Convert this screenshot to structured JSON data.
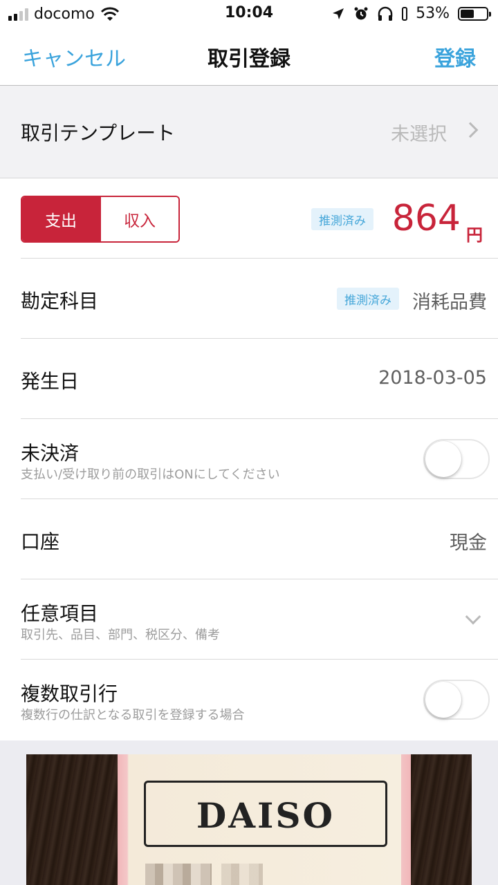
{
  "status_bar": {
    "carrier": "docomo",
    "time": "10:04",
    "battery_percent_text": "53%",
    "battery_level": 0.53
  },
  "nav": {
    "cancel_label": "キャンセル",
    "title": "取引登録",
    "register_label": "登録"
  },
  "template": {
    "label": "取引テンプレート",
    "value": "未選択"
  },
  "amount_row": {
    "expense_label": "支出",
    "income_label": "収入",
    "selected": "expense",
    "estimated_badge": "推測済み",
    "amount": "864",
    "currency": "円"
  },
  "account_item": {
    "label": "勘定科目",
    "estimated_badge": "推測済み",
    "value": "消耗品費"
  },
  "date": {
    "label": "発生日",
    "value": "2018-03-05"
  },
  "unsettled": {
    "label": "未決済",
    "sub": "支払い/受け取り前の取引はONにしてください",
    "on": false
  },
  "wallet": {
    "label": "口座",
    "value": "現金"
  },
  "optional": {
    "label": "任意項目",
    "sub": "取引先、品目、部門、税区分、備考"
  },
  "multi_line": {
    "label": "複数取引行",
    "sub": "複数行の仕訳となる取引を登録する場合",
    "on": false
  },
  "receipt": {
    "logo_text": "DAISO"
  },
  "colors": {
    "accent_blue": "#3aa3dc",
    "expense_red": "#c8243a",
    "badge_bg": "#e4f2fb"
  }
}
